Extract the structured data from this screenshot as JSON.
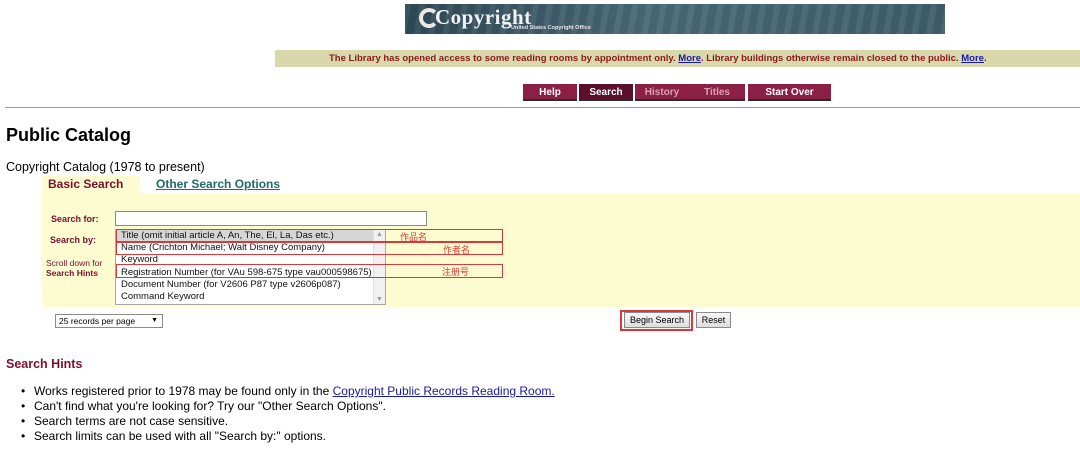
{
  "banner": {
    "logo_text": "Copyright",
    "logo_subtitle": "United States Copyright Office"
  },
  "notice": {
    "text_1": "The Library has opened access to some reading rooms by appointment only. ",
    "link_1": "More",
    "text_2": ". Library buildings otherwise remain closed to the public. ",
    "link_2": "More",
    "text_3": "."
  },
  "nav": {
    "help": "Help",
    "search": "Search",
    "history": "History",
    "titles": "Titles",
    "start_over": "Start Over"
  },
  "page": {
    "title": "Public Catalog",
    "subtitle": "Copyright Catalog (1978 to present)"
  },
  "search_tabs": {
    "basic": "Basic Search",
    "other": "Other Search Options"
  },
  "form": {
    "search_for_label": "Search for:",
    "search_for_value": "",
    "search_by_label": "Search by:",
    "scroll_hint_line1": "Scroll down for",
    "scroll_hint_line2": "Search Hints",
    "search_by_options": [
      "Title (omit initial article A, An, The, El, La, Das etc.)",
      "Name (Crichton Michael; Walt Disney Company)",
      "Keyword",
      "Registration Number (for VAu 598-675 type vau000598675)",
      "Document Number (for V2606 P87 type v2606p087)",
      "Command Keyword"
    ],
    "selected_option_index": 0,
    "records_per_page": "25 records per page",
    "begin_search": "Begin Search",
    "reset": "Reset"
  },
  "annotations": {
    "title_note": "作品名",
    "name_note": "作者名",
    "registration_note": "注册号",
    "color": "#d63a3a"
  },
  "hints": {
    "title": "Search Hints",
    "item_1_text": "Works registered prior to 1978 may be found only in the ",
    "item_1_link": "Copyright Public Records Reading Room.",
    "item_2": "Can't find what you're looking for? Try our \"Other Search Options\".",
    "item_3": "Search terms are not case sensitive.",
    "item_4": "Search limits can be used with all \"Search by:\" options."
  },
  "colors": {
    "brand_maroon": "#8c1f44",
    "panel_yellow": "#fdfbd0",
    "notice_bg": "#d9d8aa",
    "link_blue": "#1a1aa6"
  }
}
